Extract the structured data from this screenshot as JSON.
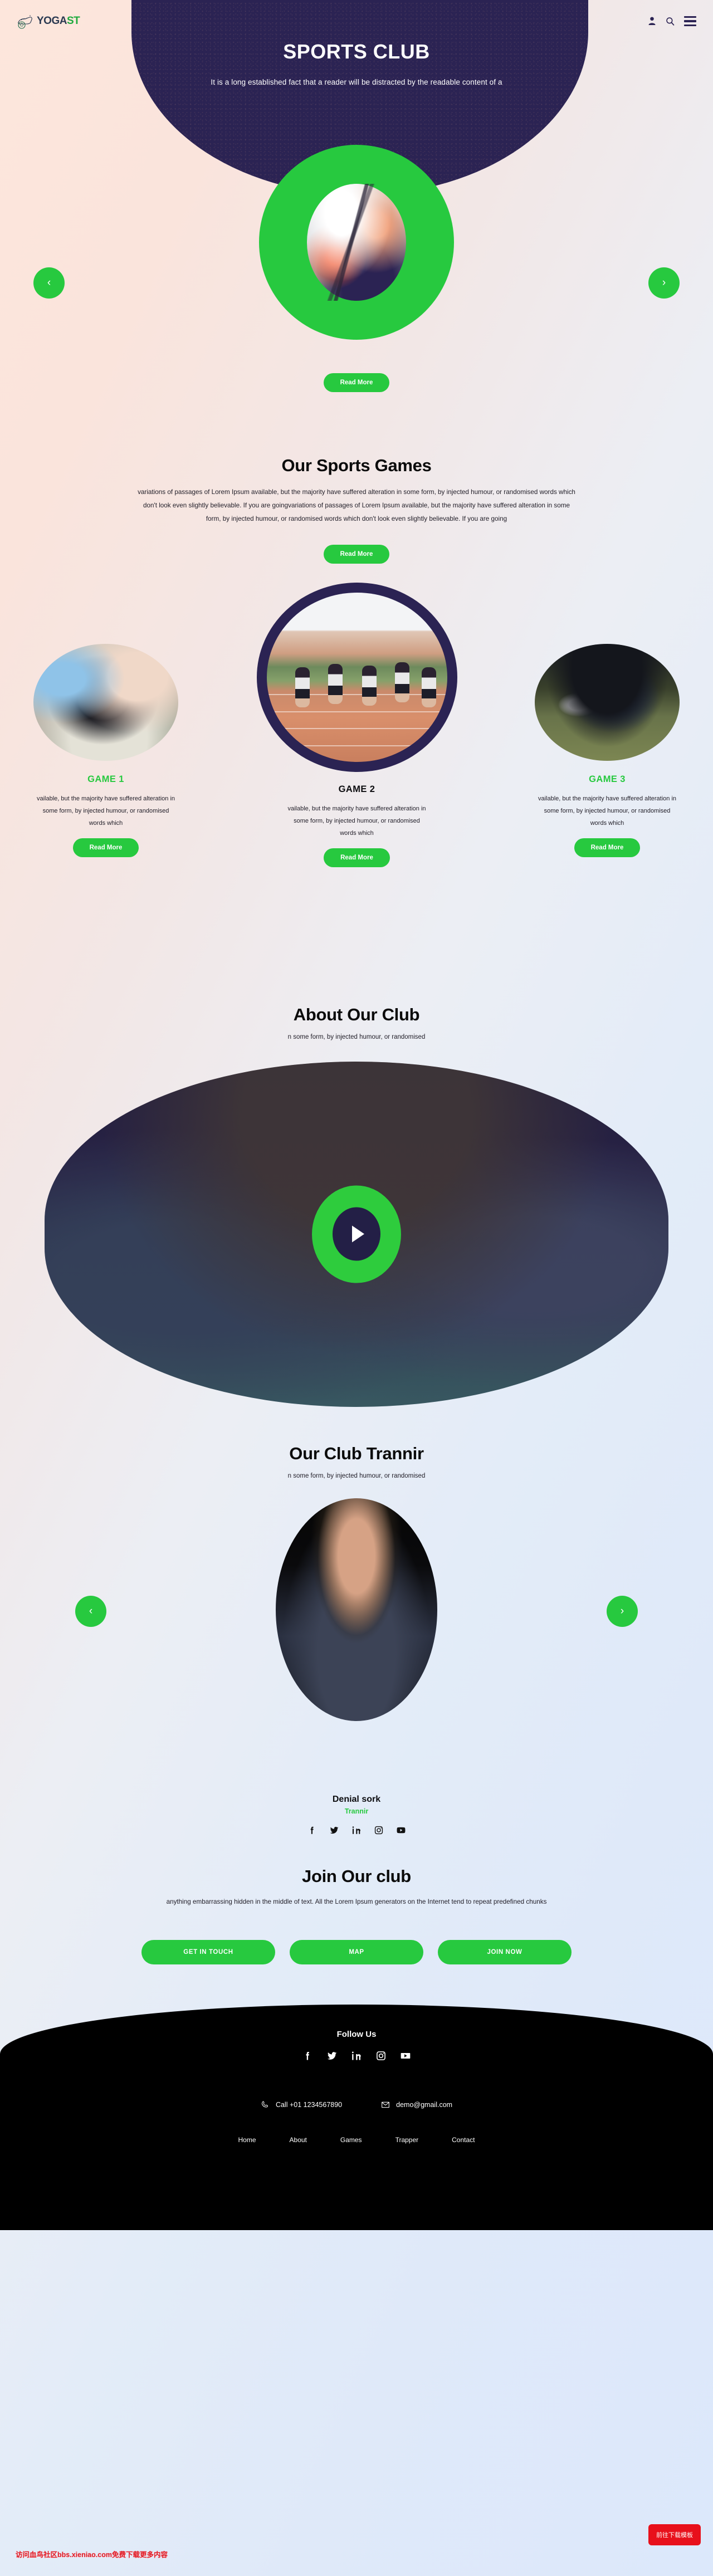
{
  "header": {
    "logo_text_a": "YOGA",
    "logo_text_b": "ST",
    "icons": [
      "user-icon",
      "search-icon",
      "menu-icon"
    ]
  },
  "hero": {
    "title": "SPORTS CLUB",
    "subtitle": "It is a long established fact that a reader will be distracted by the readable content of a",
    "read_more": "Read More",
    "prev": "‹",
    "next": "›"
  },
  "games_section": {
    "heading": "Our Sports Games",
    "paragraph": "variations of passages of Lorem Ipsum available, but the majority have suffered alteration in some form, by injected humour, or randomised words which don't look even slightly believable. If you are goingvariations of passages of Lorem Ipsum available, but the majority have suffered alteration in some form, by injected humour, or randomised words which don't look even slightly believable. If you are going",
    "read_more": "Read More",
    "cards": [
      {
        "title": "GAME 1",
        "text": "vailable, but the majority have suffered alteration in some form, by injected humour, or randomised words which",
        "button": "Read More"
      },
      {
        "title": "GAME 2",
        "text": "vailable, but the majority have suffered alteration in some form, by injected humour, or randomised words which",
        "button": "Read More"
      },
      {
        "title": "GAME 3",
        "text": "vailable, but the majority have suffered alteration in some form, by injected humour, or randomised words which",
        "button": "Read More"
      }
    ]
  },
  "about_section": {
    "heading": "About Our Club",
    "subtitle": "n some form, by injected humour, or randomised",
    "play_label": "play-video"
  },
  "trainer_section": {
    "heading": "Our Club Trannir",
    "subtitle": "n some form, by injected humour, or randomised",
    "name": "Denial sork",
    "role": "Trannir",
    "prev": "‹",
    "next": "›",
    "socials": [
      "facebook-icon",
      "twitter-icon",
      "linkedin-icon",
      "instagram-icon",
      "youtube-icon"
    ]
  },
  "join_section": {
    "heading": "Join Our club",
    "paragraph": "anything embarrassing hidden in the middle of text. All the Lorem Ipsum generators on the Internet tend to repeat predefined chunks",
    "buttons": [
      "GET IN TOUCH",
      "MAP",
      "JOIN NOW"
    ]
  },
  "footer": {
    "follow_heading": "Follow Us",
    "socials": [
      "facebook-icon",
      "twitter-icon",
      "linkedin-icon",
      "instagram-icon",
      "youtube-icon"
    ],
    "phone": "Call +01 1234567890",
    "email": "demo@gmail.com",
    "nav": [
      "Home",
      "About",
      "Games",
      "Trapper",
      "Contact"
    ]
  },
  "overlay": {
    "watermark": "访问血鸟社区bbs.xieniao.com免费下载更多内容",
    "download_button": "前往下载模板"
  },
  "colors": {
    "accent_green": "#27c93f",
    "navy": "#2b2353",
    "black": "#000000",
    "red": "#e8101b"
  }
}
